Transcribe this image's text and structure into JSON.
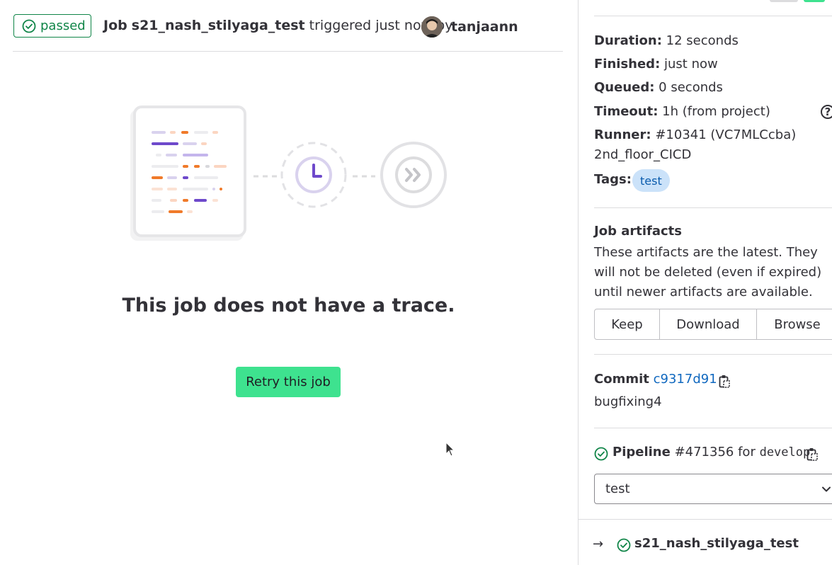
{
  "header": {
    "status": "passed",
    "job_prefix": "Job",
    "job_name": "s21_nash_stilyaga_test",
    "triggered_text": "triggered just now by",
    "username": "tanjaann"
  },
  "empty_state": {
    "title": "This job does not have a trace.",
    "retry_label": "Retry this job"
  },
  "sidebar": {
    "duration_label": "Duration:",
    "duration_value": "12 seconds",
    "finished_label": "Finished:",
    "finished_value": "just now",
    "queued_label": "Queued:",
    "queued_value": "0 seconds",
    "timeout_label": "Timeout:",
    "timeout_value": "1h (from project)",
    "runner_label": "Runner:",
    "runner_value": "#10341 (VC7MLCcba)",
    "runner_name": "2nd_floor_CICD",
    "tags_label": "Tags:",
    "tag": "test",
    "artifacts_title": "Job artifacts",
    "artifacts_desc": "These artifacts are the latest. They will not be deleted (even if expired) until newer artifacts are available.",
    "keep_label": "Keep",
    "download_label": "Download",
    "browse_label": "Browse",
    "commit_label": "Commit",
    "commit_sha": "c9317d91",
    "commit_message": "bugfixing4",
    "pipeline_label": "Pipeline",
    "pipeline_id": "#471356",
    "pipeline_for": "for",
    "branch": "develop",
    "stage_select": "test",
    "current_job_arrow": "→",
    "current_job": "s21_nash_stilyaga_test"
  },
  "colors": {
    "success": "#108548",
    "primary_button": "#3ee28f",
    "link": "#1068bf",
    "tag_bg": "#cbe2f9"
  },
  "icons": [
    "check-circle-icon",
    "clock-icon",
    "skip-forward-icon",
    "clipboard-icon",
    "help-icon",
    "chevron-down-icon",
    "arrow-right-icon",
    "mouse-cursor-icon"
  ]
}
